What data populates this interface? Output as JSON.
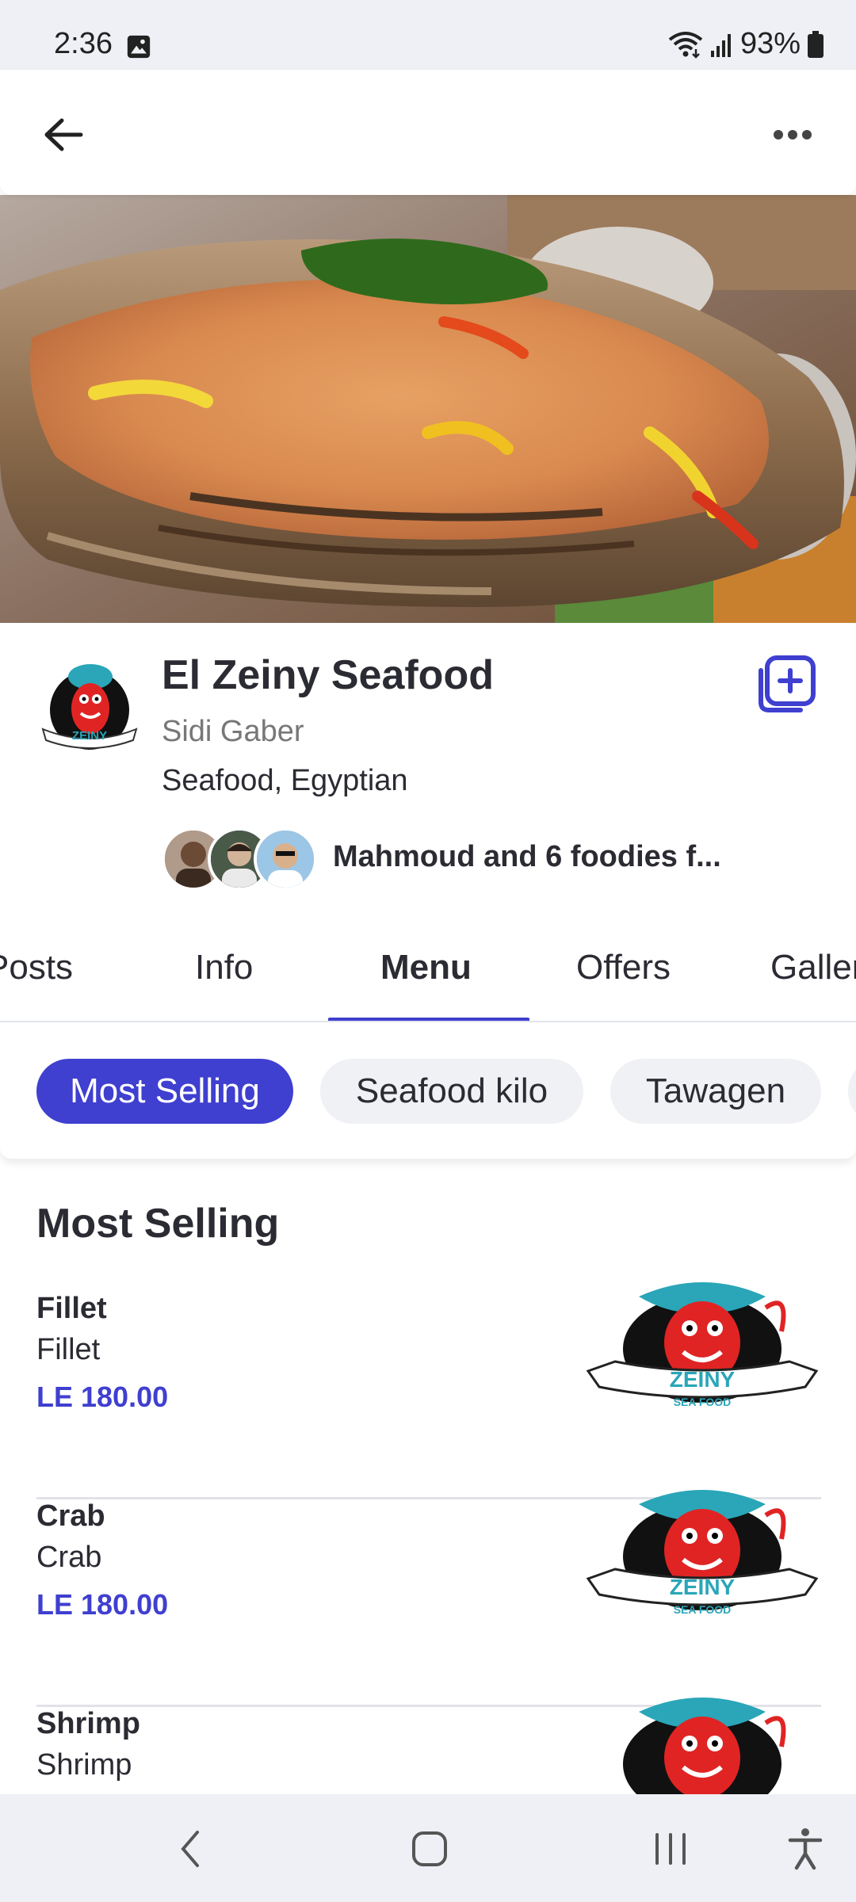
{
  "status_bar": {
    "time": "2:36",
    "battery": "93%"
  },
  "restaurant": {
    "name": "El Zeiny Seafood",
    "area": "Sidi Gaber",
    "cuisine": "Seafood, Egyptian",
    "foodies_text": "Mahmoud and 6 foodies f..."
  },
  "tabs": [
    {
      "label": "Posts"
    },
    {
      "label": "Info"
    },
    {
      "label": "Menu"
    },
    {
      "label": "Offers"
    },
    {
      "label": "Gallery"
    }
  ],
  "active_tab": "Menu",
  "chips": [
    {
      "label": "Most Selling"
    },
    {
      "label": "Seafood kilo"
    },
    {
      "label": "Tawagen"
    }
  ],
  "menu": {
    "section_title": "Most Selling",
    "items": [
      {
        "name": "Fillet",
        "description": "Fillet",
        "price": "LE 180.00"
      },
      {
        "name": "Crab",
        "description": "Crab",
        "price": "LE 180.00"
      },
      {
        "name": "Shrimp",
        "description": "Shrimp",
        "price": ""
      }
    ]
  },
  "logo_text": {
    "brand": "ZEINY",
    "sub": "SEA FOOD"
  },
  "colors": {
    "accent": "#3f3fd0",
    "chip_bg": "#f0f1f5",
    "bars": "#eef0f5"
  },
  "icons": [
    "image-icon",
    "wifi-icon",
    "signal-icon",
    "battery-icon",
    "back-arrow-icon",
    "more-dots-icon",
    "add-collection-icon",
    "nav-back-icon",
    "nav-home-icon",
    "nav-recents-icon",
    "accessibility-icon"
  ]
}
